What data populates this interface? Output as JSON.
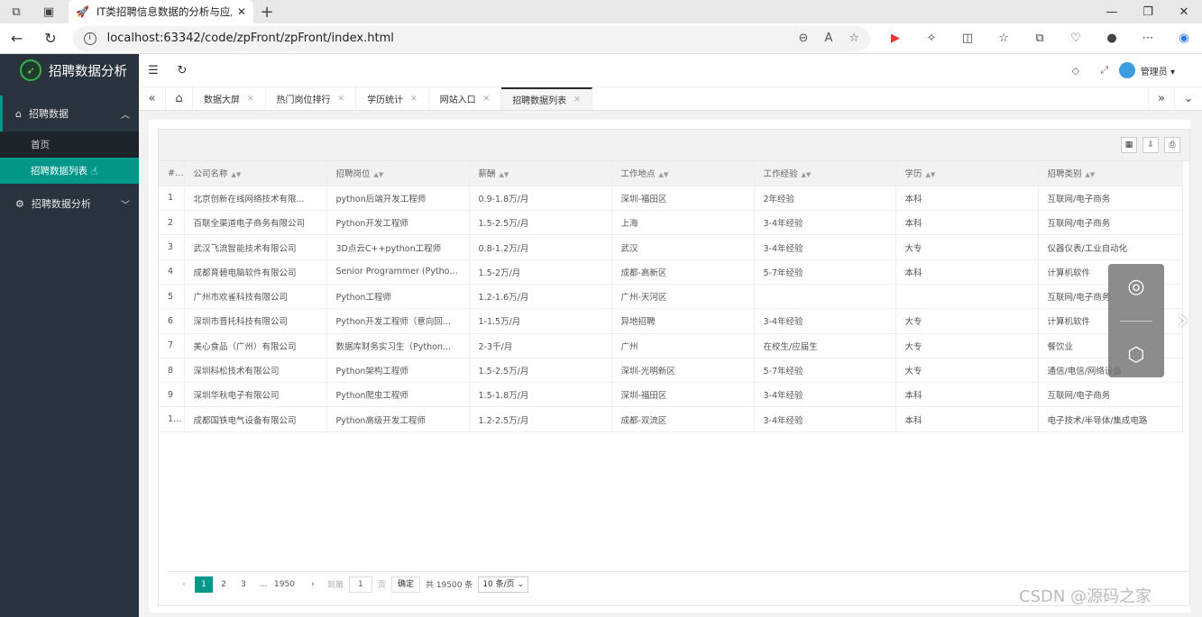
{
  "browser": {
    "tab_title": "IT类招聘信息数据的分析与应用系",
    "url": "localhost:63342/code/zpFront/zpFront/index.html"
  },
  "sidebar": {
    "logo": "招聘数据分析",
    "groups": [
      {
        "label": "招聘数据",
        "items": [
          "首页",
          "招聘数据列表"
        ]
      },
      {
        "label": "招聘数据分析"
      }
    ]
  },
  "topbar": {
    "admin": "管理员"
  },
  "page_tabs": [
    "数据大屏",
    "热门岗位排行",
    "学历统计",
    "网站入口",
    "招聘数据列表"
  ],
  "table": {
    "columns": [
      "#",
      "公司名称",
      "招聘岗位",
      "薪酬",
      "工作地点",
      "工作经验",
      "学历",
      "招聘类别"
    ],
    "rows": [
      [
        "1",
        "北京创新在线网络技术有限...",
        "python后端开发工程师",
        "0.9-1.8万/月",
        "深圳-福田区",
        "2年经验",
        "本科",
        "互联网/电子商务"
      ],
      [
        "2",
        "百联全渠道电子商务有限公司",
        "Python开发工程师",
        "1.5-2.5万/月",
        "上海",
        "3-4年经验",
        "本科",
        "互联网/电子商务"
      ],
      [
        "3",
        "武汉飞流智能技术有限公司",
        "3D点云C++python工程师",
        "0.8-1.2万/月",
        "武汉",
        "3-4年经验",
        "大专",
        "仪器仪表/工业自动化"
      ],
      [
        "4",
        "成都育碧电脑软件有限公司",
        "Senior Programmer (Python ...",
        "1.5-2万/月",
        "成都-高新区",
        "5-7年经验",
        "本科",
        "计算机软件"
      ],
      [
        "5",
        "广州市欢雀科技有限公司",
        "Python工程师",
        "1.2-1.6万/月",
        "广州-天河区",
        "",
        "",
        "互联网/电子商务"
      ],
      [
        "6",
        "深圳市晋托科技有限公司",
        "Python开发工程师（意向回...",
        "1-1.5万/月",
        "异地招聘",
        "3-4年经验",
        "大专",
        "计算机软件"
      ],
      [
        "7",
        "美心食品（广州）有限公司",
        "数据库财务实习生（Python...",
        "2-3千/月",
        "广州",
        "在校生/应届生",
        "大专",
        "餐饮业"
      ],
      [
        "8",
        "深圳科松技术有限公司",
        "Python架构工程师",
        "1.5-2.5万/月",
        "深圳-光明新区",
        "5-7年经验",
        "大专",
        "通信/电信/网络设备"
      ],
      [
        "9",
        "深圳华秋电子有限公司",
        "Python爬虫工程师",
        "1.5-1.8万/月",
        "深圳-福田区",
        "3-4年经验",
        "本科",
        "互联网/电子商务"
      ],
      [
        "10",
        "成都国铁电气设备有限公司",
        "Python高级开发工程师",
        "1.2-2.5万/月",
        "成都-双流区",
        "3-4年经验",
        "本科",
        "电子技术/半导体/集成电路"
      ]
    ]
  },
  "pager": {
    "pages": [
      "1",
      "2",
      "3",
      "...",
      "1950"
    ],
    "goto": "到第",
    "page_val": "1",
    "page_unit": "页",
    "ok": "确定",
    "total": "共 19500 条",
    "size": "10 条/页"
  },
  "watermark": "CSDN @源码之家"
}
